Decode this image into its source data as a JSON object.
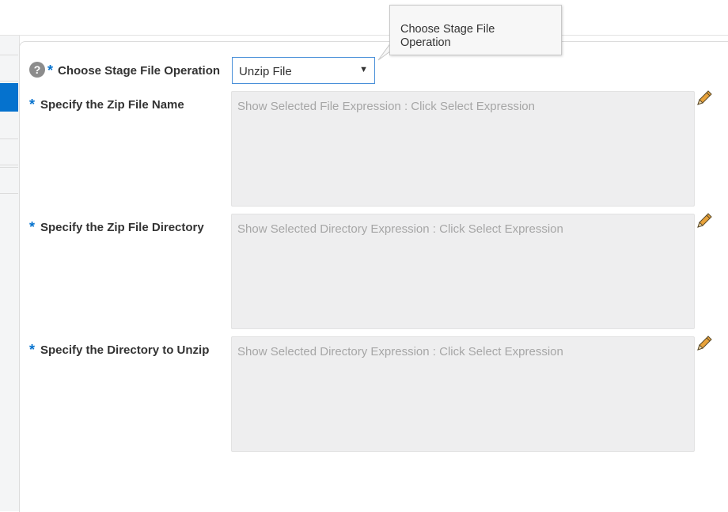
{
  "tooltip": {
    "text": "Choose Stage File Operation"
  },
  "operation": {
    "help_icon_glyph": "?",
    "required_mark": "*",
    "label": "Choose Stage File Operation",
    "selected_value": "Unzip File"
  },
  "fields": [
    {
      "required_mark": "*",
      "label": "Specify the Zip File Name",
      "placeholder": "Show Selected File Expression : Click Select Expression",
      "edit_icon": "pencil-icon"
    },
    {
      "required_mark": "*",
      "label": "Specify the Zip File Directory",
      "placeholder": "Show Selected Directory Expression : Click Select Expression",
      "edit_icon": "pencil-icon"
    },
    {
      "required_mark": "*",
      "label": "Specify the Directory to Unzip",
      "placeholder": "Show Selected Directory Expression : Click Select Expression",
      "edit_icon": "pencil-icon"
    }
  ],
  "colors": {
    "accent": "#0572ce",
    "field_background": "#eeeeef",
    "placeholder_text": "#a6a6a6",
    "required_mark": "#0572ce"
  }
}
